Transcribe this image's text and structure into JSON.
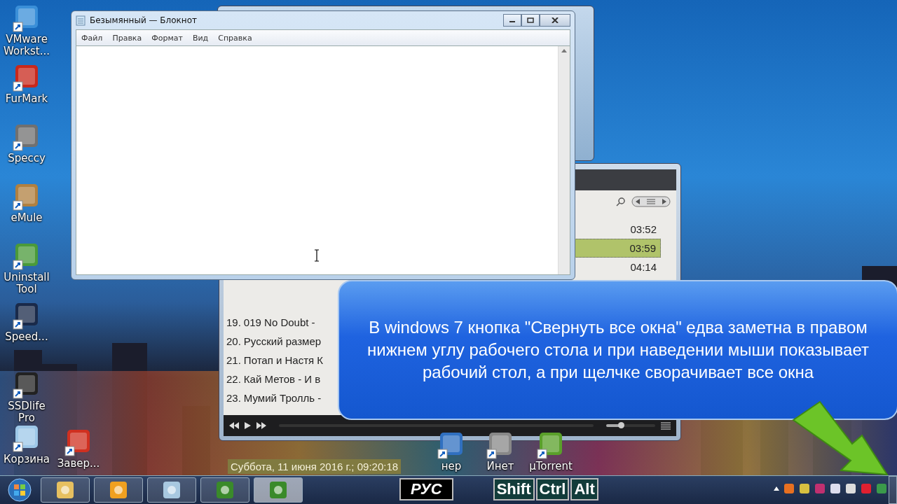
{
  "desktop_icons": [
    {
      "label": "VMware Workst..."
    },
    {
      "label": "FurMark"
    },
    {
      "label": "Speccy"
    },
    {
      "label": "eMule"
    },
    {
      "label": "Uninstall Tool"
    },
    {
      "label": "Speed..."
    },
    {
      "label": "SSDlife Pro"
    },
    {
      "label": "Корзина"
    },
    {
      "label": "Завер..."
    },
    {
      "label": "нер"
    },
    {
      "label": "Инет"
    },
    {
      "label": "µTorrent"
    }
  ],
  "notepad": {
    "title": "Безымянный — Блокнот",
    "menu": [
      "Файл",
      "Правка",
      "Формат",
      "Вид",
      "Справка"
    ]
  },
  "player": {
    "times": [
      {
        "time": "03:52",
        "selected": false
      },
      {
        "time": "03:59",
        "selected": true
      },
      {
        "time": "04:14",
        "selected": false
      }
    ],
    "tracks": [
      {
        "number": "19.",
        "title": "019 No Doubt -"
      },
      {
        "number": "20.",
        "title": "Русский размер"
      },
      {
        "number": "21.",
        "title": "Потап и Настя К"
      },
      {
        "number": "22.",
        "title": "Кай Метов - И в"
      },
      {
        "number": "23.",
        "title": "Мумий Тролль -"
      }
    ],
    "volume": {
      "level": 0.3
    }
  },
  "callout": "В windows 7 кнопка \"Свернуть все окна\" едва заметна в правом нижнем углу рабочего стола и при наведении мыши показывает рабочий стол, а при щелчке сворачивает все окна",
  "date_overlay": "Суббота, 11 июня 2016 г.; 09:20:18",
  "keys": [
    {
      "label": "РУС",
      "kind": "layout"
    },
    {
      "label": "Shift",
      "kind": "modifier"
    },
    {
      "label": "Ctrl",
      "kind": "modifier"
    },
    {
      "label": "Alt",
      "kind": "modifier"
    }
  ],
  "taskbar": {
    "buttons": [
      {
        "selected": false
      },
      {
        "selected": false
      },
      {
        "selected": false
      },
      {
        "selected": false
      },
      {
        "selected": true
      }
    ]
  }
}
